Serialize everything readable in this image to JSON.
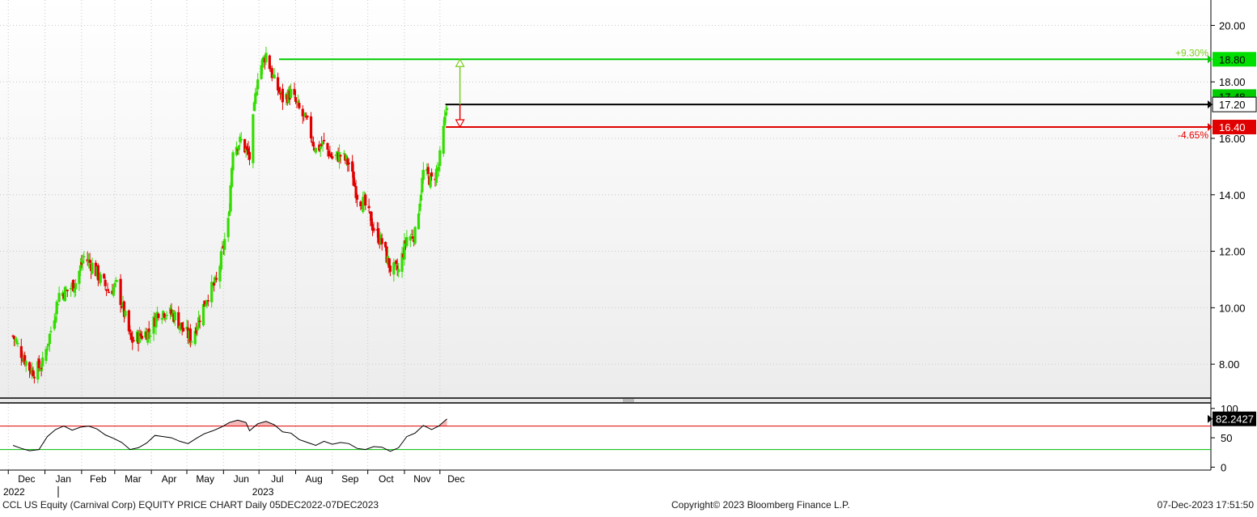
{
  "chart_data": [
    {
      "type": "candlestick",
      "ylim": [
        6.8,
        20.9
      ],
      "y_ticks": [
        8.0,
        10.0,
        12.0,
        14.0,
        16.0,
        18.0,
        20.0
      ],
      "y_tick_labels": [
        "8.00",
        "10.00",
        "12.00",
        "14.00",
        "16.00",
        "18.00",
        "20.00"
      ],
      "grid": true,
      "up_color": "#33dd00",
      "down_color": "#e00000",
      "x_start": "2022-12-05",
      "x_end": "2023-12-07",
      "x_tick_labels": [
        "Dec",
        "Jan",
        "Feb",
        "Mar",
        "Apr",
        "May",
        "Jun",
        "Jul",
        "Aug",
        "Sep",
        "Oct",
        "Nov",
        "Dec"
      ],
      "x_tick_dates": [
        "2022-12-01",
        "2023-01-01",
        "2023-02-01",
        "2023-03-01",
        "2023-04-01",
        "2023-05-01",
        "2023-06-01",
        "2023-07-01",
        "2023-08-01",
        "2023-09-01",
        "2023-10-01",
        "2023-11-01",
        "2023-12-01"
      ],
      "year_labels": [
        {
          "date": "2022-12-05",
          "label": "2022"
        },
        {
          "date": "2023-06-15",
          "label": "2023"
        }
      ],
      "series": [
        {
          "type": "close_path",
          "points": [
            [
              "2022-12-05",
              9.0
            ],
            [
              "2022-12-12",
              8.4
            ],
            [
              "2022-12-19",
              7.85
            ],
            [
              "2022-12-23",
              7.75
            ],
            [
              "2022-12-30",
              8.0
            ],
            [
              "2023-01-06",
              9.2
            ],
            [
              "2023-01-13",
              10.5
            ],
            [
              "2023-01-20",
              10.6
            ],
            [
              "2023-01-27",
              10.9
            ],
            [
              "2023-02-03",
              11.8
            ],
            [
              "2023-02-10",
              11.5
            ],
            [
              "2023-02-17",
              11.0
            ],
            [
              "2023-02-24",
              10.6
            ],
            [
              "2023-03-03",
              10.8
            ],
            [
              "2023-03-09",
              9.8
            ],
            [
              "2023-03-15",
              8.8
            ],
            [
              "2023-03-22",
              9.0
            ],
            [
              "2023-03-31",
              9.2
            ],
            [
              "2023-04-07",
              9.9
            ],
            [
              "2023-04-14",
              9.85
            ],
            [
              "2023-04-21",
              9.7
            ],
            [
              "2023-04-28",
              9.2
            ],
            [
              "2023-05-05",
              8.9
            ],
            [
              "2023-05-12",
              9.7
            ],
            [
              "2023-05-19",
              10.5
            ],
            [
              "2023-05-26",
              10.9
            ],
            [
              "2023-06-02",
              12.4
            ],
            [
              "2023-06-05",
              13.0
            ],
            [
              "2023-06-09",
              15.7
            ],
            [
              "2023-06-16",
              15.9
            ],
            [
              "2023-06-23",
              15.3
            ],
            [
              "2023-06-30",
              18.3
            ],
            [
              "2023-07-07",
              19.0
            ],
            [
              "2023-07-14",
              18.0
            ],
            [
              "2023-07-21",
              17.4
            ],
            [
              "2023-07-28",
              17.6
            ],
            [
              "2023-08-04",
              17.0
            ],
            [
              "2023-08-11",
              16.5
            ],
            [
              "2023-08-18",
              15.6
            ],
            [
              "2023-08-25",
              15.8
            ],
            [
              "2023-09-01",
              15.3
            ],
            [
              "2023-09-08",
              15.4
            ],
            [
              "2023-09-15",
              15.1
            ],
            [
              "2023-09-22",
              14.0
            ],
            [
              "2023-09-29",
              13.6
            ],
            [
              "2023-10-06",
              12.8
            ],
            [
              "2023-10-13",
              12.3
            ],
            [
              "2023-10-20",
              11.4
            ],
            [
              "2023-10-27",
              11.3
            ],
            [
              "2023-11-03",
              12.5
            ],
            [
              "2023-11-10",
              12.6
            ],
            [
              "2023-11-17",
              14.8
            ],
            [
              "2023-11-24",
              14.5
            ],
            [
              "2023-11-30",
              15.0
            ],
            [
              "2023-12-05",
              16.6
            ],
            [
              "2023-12-07",
              17.3
            ]
          ]
        }
      ],
      "annotations": [
        {
          "type": "hline",
          "label": "18.80",
          "value": 18.8,
          "start_date": "2023-07-18",
          "color": "#00cc00"
        },
        {
          "type": "hline",
          "label": "17.20",
          "value": 17.2,
          "start_date": "2023-12-07",
          "color": "#000000"
        },
        {
          "type": "hline",
          "label": "16.40",
          "value": 16.4,
          "start_date": "2023-12-06",
          "color": "#e00000"
        },
        {
          "type": "price_tag",
          "label": "17.48",
          "value": 17.48,
          "color": "#00cc00"
        },
        {
          "type": "percent",
          "label": "+9.30%",
          "value": 18.8,
          "color": "#7ccd20"
        },
        {
          "type": "percent",
          "label": "-4.65%",
          "value": 16.4,
          "color": "#e80000"
        }
      ]
    },
    {
      "type": "line",
      "indicator": "RSI",
      "ylim": [
        -5,
        108
      ],
      "y_ticks": [
        0,
        50,
        100
      ],
      "y_tick_labels": [
        "0",
        "50",
        "100"
      ],
      "overbought": 70,
      "oversold": 30,
      "overbought_color": "#e00000",
      "oversold_color": "#00bb00",
      "last_value": 82.2427,
      "last_value_label": "82.2427",
      "points": [
        [
          "2022-12-05",
          37
        ],
        [
          "2022-12-12",
          32
        ],
        [
          "2022-12-19",
          28
        ],
        [
          "2022-12-27",
          30
        ],
        [
          "2023-01-03",
          52
        ],
        [
          "2023-01-10",
          64
        ],
        [
          "2023-01-17",
          70
        ],
        [
          "2023-01-24",
          63
        ],
        [
          "2023-01-31",
          68
        ],
        [
          "2023-02-07",
          70
        ],
        [
          "2023-02-14",
          65
        ],
        [
          "2023-02-21",
          55
        ],
        [
          "2023-02-28",
          49
        ],
        [
          "2023-03-07",
          42
        ],
        [
          "2023-03-14",
          30
        ],
        [
          "2023-03-21",
          33
        ],
        [
          "2023-03-28",
          41
        ],
        [
          "2023-04-04",
          54
        ],
        [
          "2023-04-11",
          52
        ],
        [
          "2023-04-18",
          50
        ],
        [
          "2023-04-25",
          44
        ],
        [
          "2023-05-02",
          40
        ],
        [
          "2023-05-09",
          49
        ],
        [
          "2023-05-16",
          57
        ],
        [
          "2023-05-23",
          62
        ],
        [
          "2023-05-30",
          68
        ],
        [
          "2023-06-06",
          76
        ],
        [
          "2023-06-13",
          80
        ],
        [
          "2023-06-20",
          76
        ],
        [
          "2023-06-23",
          62
        ],
        [
          "2023-06-30",
          74
        ],
        [
          "2023-07-07",
          78
        ],
        [
          "2023-07-14",
          72
        ],
        [
          "2023-07-21",
          60
        ],
        [
          "2023-07-28",
          58
        ],
        [
          "2023-08-04",
          47
        ],
        [
          "2023-08-11",
          42
        ],
        [
          "2023-08-18",
          37
        ],
        [
          "2023-08-25",
          44
        ],
        [
          "2023-09-01",
          39
        ],
        [
          "2023-09-08",
          42
        ],
        [
          "2023-09-15",
          40
        ],
        [
          "2023-09-22",
          32
        ],
        [
          "2023-09-29",
          30
        ],
        [
          "2023-10-06",
          35
        ],
        [
          "2023-10-13",
          34
        ],
        [
          "2023-10-20",
          27
        ],
        [
          "2023-10-27",
          33
        ],
        [
          "2023-11-03",
          52
        ],
        [
          "2023-11-10",
          58
        ],
        [
          "2023-11-17",
          71
        ],
        [
          "2023-11-24",
          64
        ],
        [
          "2023-11-30",
          70
        ],
        [
          "2023-12-07",
          82.2427
        ]
      ]
    }
  ],
  "footer": {
    "left": "CCL US Equity (Carnival Corp) EQUITY PRICE CHART  Daily 05DEC2022-07DEC2023",
    "center": "Copyright© 2023 Bloomberg Finance L.P.",
    "right": "07-Dec-2023 17:51:50"
  }
}
